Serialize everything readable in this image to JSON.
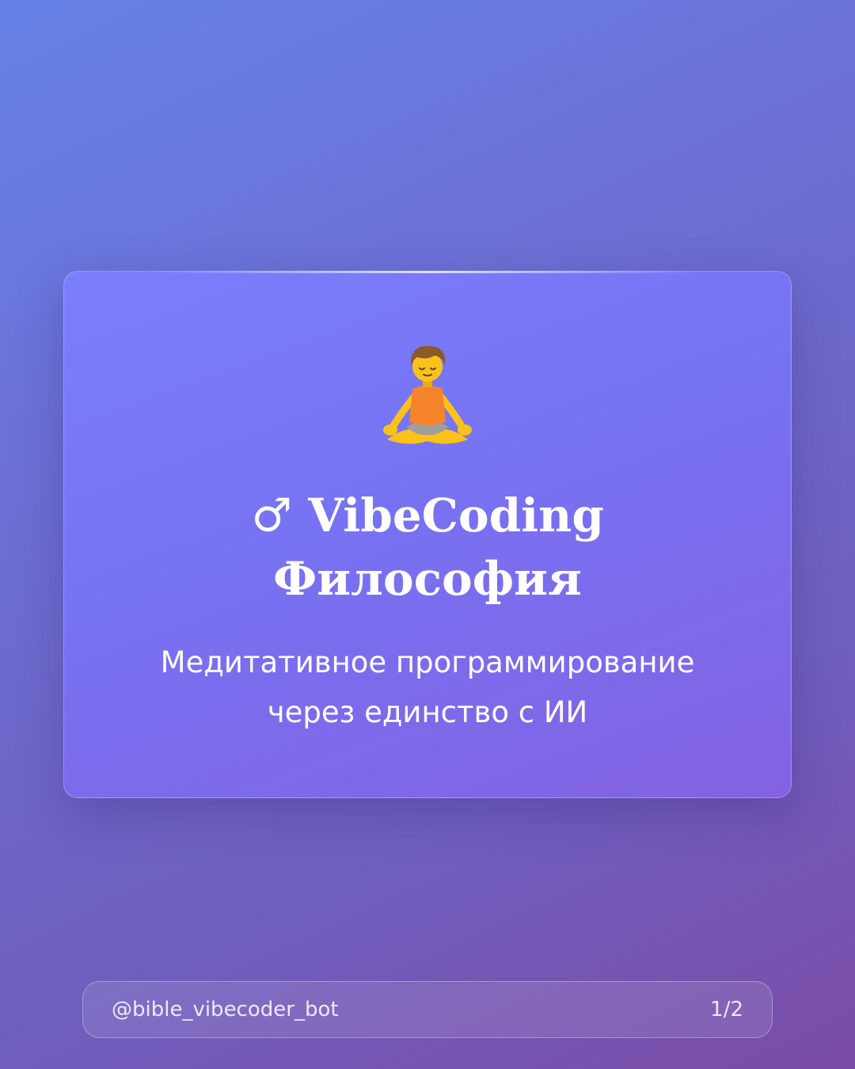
{
  "card": {
    "icon": "person-in-lotus-position-icon",
    "title_line1": "♂ VibeCoding",
    "title_line2": "Философия",
    "subtitle_line1": "Медитативное программирование",
    "subtitle_line2": "через единство с ИИ"
  },
  "footer": {
    "handle": "@bible_vibecoder_bot",
    "page_indicator": "1/2"
  },
  "colors": {
    "card_fill": "#7a7ffb",
    "text": "#ffffff",
    "shirt": "#f5842a",
    "skin": "#fcc21b",
    "hair": "#8a5a28",
    "legs": "#9e9e9e"
  }
}
